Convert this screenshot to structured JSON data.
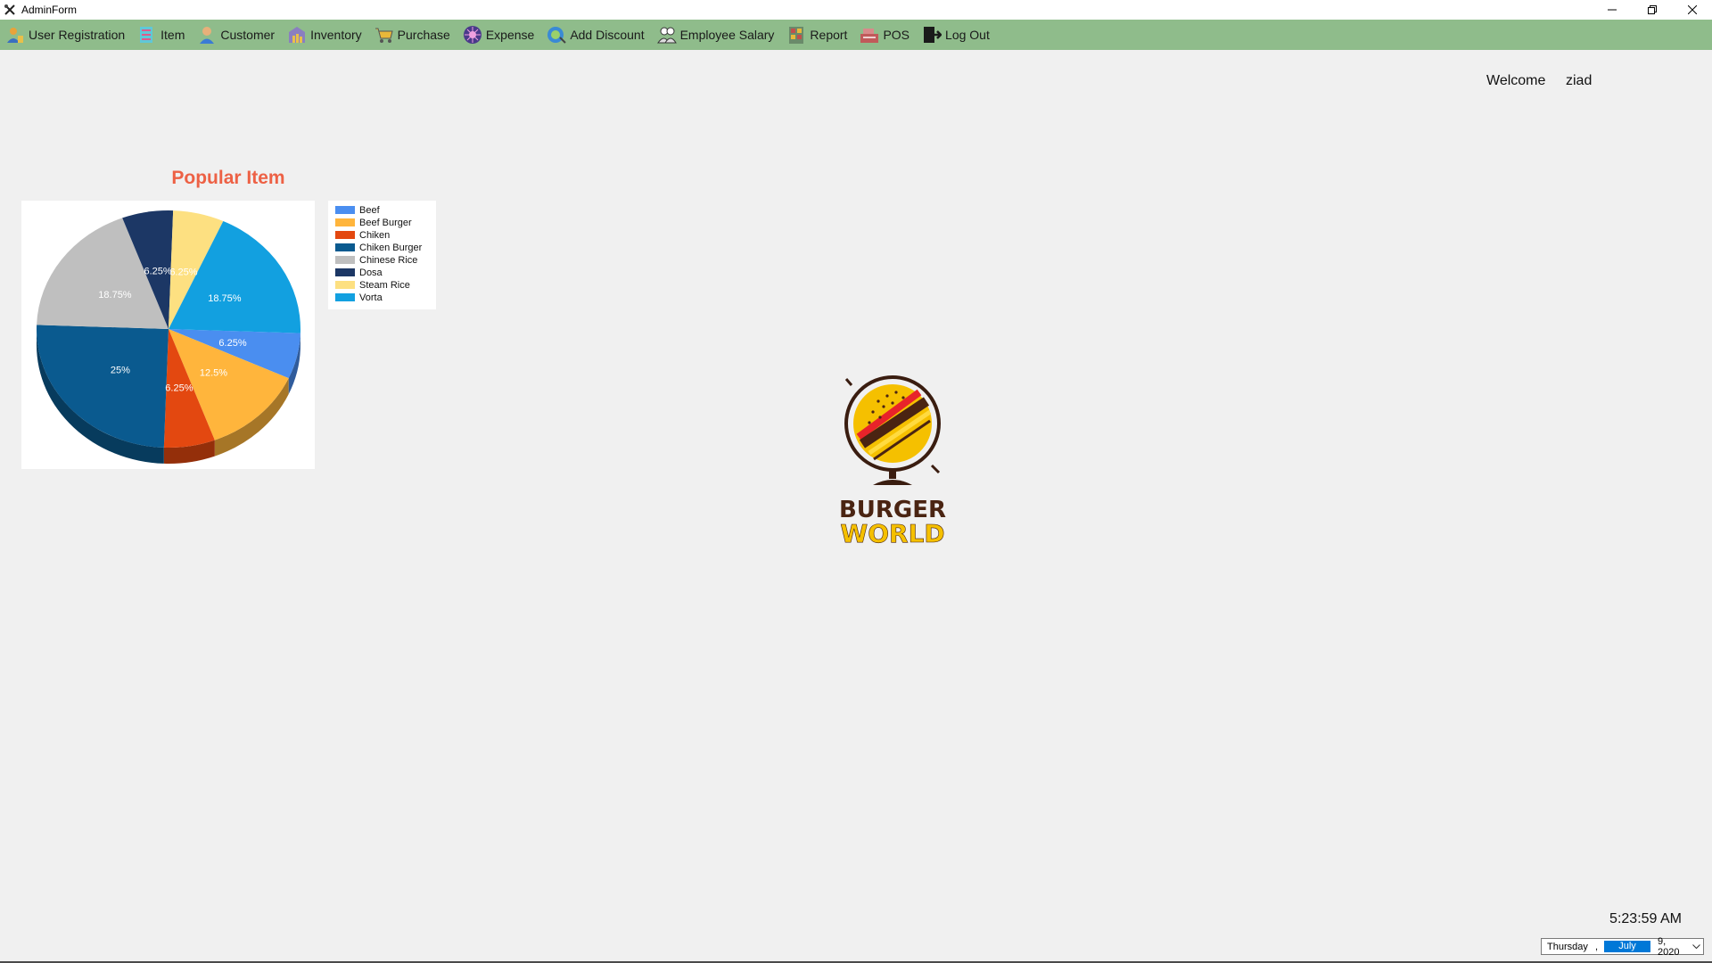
{
  "window": {
    "title": "AdminForm"
  },
  "menu": {
    "items": [
      {
        "label": "User Registration",
        "icon": "user-registration-icon",
        "color": "#e8a33a"
      },
      {
        "label": "Item",
        "icon": "item-icon",
        "color": "#5fc8d8"
      },
      {
        "label": "Customer",
        "icon": "customer-icon",
        "color": "#3a7bd5"
      },
      {
        "label": "Inventory",
        "icon": "inventory-icon",
        "color": "#8a7fc0"
      },
      {
        "label": "Purchase",
        "icon": "cart-icon",
        "color": "#e8b83a"
      },
      {
        "label": "Expense",
        "icon": "expense-icon",
        "color": "#4a3a8a"
      },
      {
        "label": "Add Discount",
        "icon": "discount-icon",
        "color": "#3a8ad5"
      },
      {
        "label": "Employee Salary",
        "icon": "employee-salary-icon",
        "color": "#4a4a4a"
      },
      {
        "label": "Report",
        "icon": "report-icon",
        "color": "#c0504d"
      },
      {
        "label": "POS",
        "icon": "pos-icon",
        "color": "#c05a5a"
      },
      {
        "label": "Log Out",
        "icon": "logout-icon",
        "color": "#1a1a1a"
      }
    ]
  },
  "header": {
    "welcome_label": "Welcome",
    "username": "ziad"
  },
  "chart_data": {
    "type": "pie",
    "title": "Popular Item",
    "legend_position": "right",
    "series": [
      {
        "name": "Beef",
        "value": 6.25,
        "label": "6.25%",
        "color": "#4a8ef0"
      },
      {
        "name": "Beef Burger",
        "value": 12.5,
        "label": "12.5%",
        "color": "#ffb53c"
      },
      {
        "name": "Chiken",
        "value": 6.25,
        "label": "6.25%",
        "color": "#e34810"
      },
      {
        "name": "Chiken Burger",
        "value": 25,
        "label": "25%",
        "color": "#0a5a8f"
      },
      {
        "name": "Chinese Rice",
        "value": 18.75,
        "label": "18.75%",
        "color": "#bfbfbf"
      },
      {
        "name": "Dosa",
        "value": 6.25,
        "label": "6.25%",
        "color": "#1c3765"
      },
      {
        "name": "Steam Rice",
        "value": 6.25,
        "label": "6.25%",
        "color": "#fde081"
      },
      {
        "name": "Vorta",
        "value": 18.75,
        "label": "18.75%",
        "color": "#12a0e0"
      }
    ]
  },
  "logo": {
    "line1": "BURGER",
    "line2": "WORLD"
  },
  "status": {
    "time": "5:23:59 AM",
    "date": {
      "day": "Thursday",
      "separator": ",",
      "month": "July",
      "rest": "9, 2020"
    }
  }
}
